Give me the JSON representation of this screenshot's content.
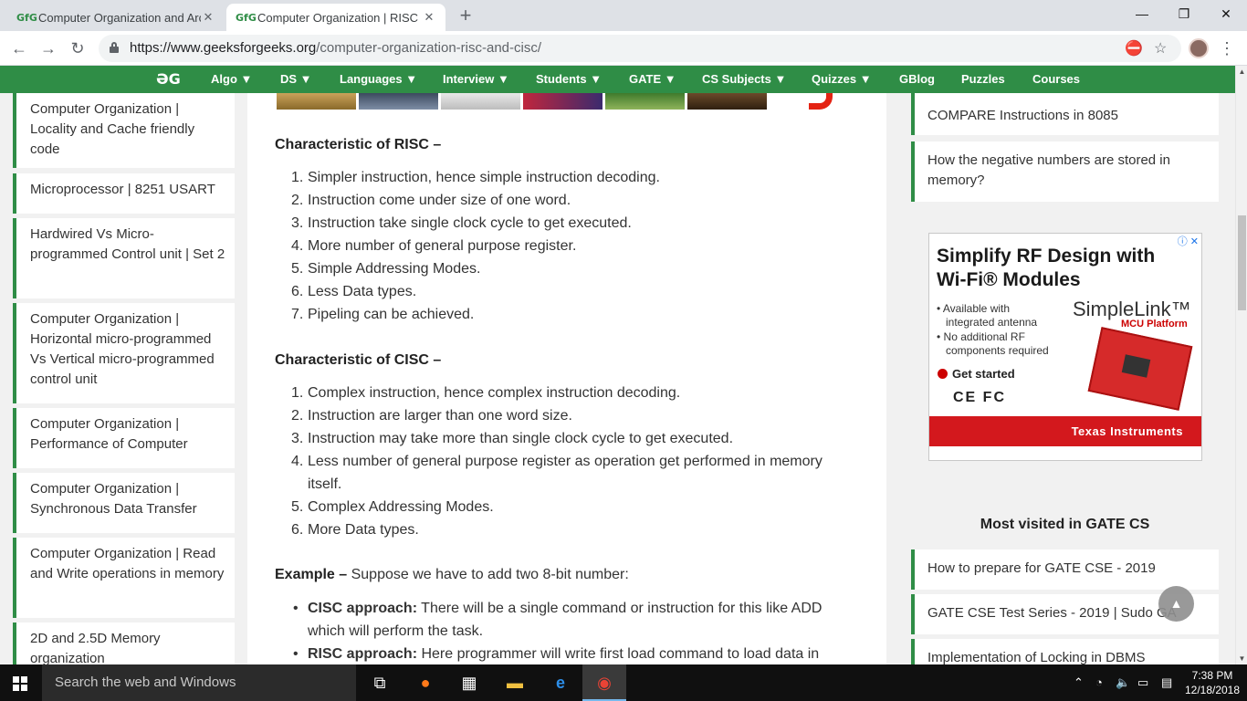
{
  "browser": {
    "tabs": [
      {
        "title": "Computer Organization and Arch",
        "favicon": "GfG"
      },
      {
        "title": "Computer Organization | RISC an",
        "favicon": "GfG"
      }
    ],
    "url_host": "https://www.geeksforgeeks.org",
    "url_path": "/computer-organization-risc-and-cisc/",
    "window_controls": {
      "minimize": "—",
      "maximize": "❐",
      "close": "✕"
    }
  },
  "site_nav": {
    "logo": "ƏG",
    "items": [
      "Algo ▼",
      "DS ▼",
      "Languages ▼",
      "Interview ▼",
      "Students ▼",
      "GATE ▼",
      "CS Subjects ▼",
      "Quizzes ▼",
      "GBlog",
      "Puzzles",
      "Courses"
    ]
  },
  "left_sidebar": {
    "items": [
      "Computer Organization | Locality and Cache friendly code",
      "Microprocessor | 8251 USART",
      "Hardwired Vs Micro-programmed Control unit | Set 2",
      "Computer Organization | Horizontal micro-programmed Vs Vertical micro-programmed control unit",
      "Computer Organization | Performance of Computer",
      "Computer Organization | Synchronous Data Transfer",
      "Computer Organization | Read and Write operations in memory",
      "2D and 2.5D Memory organization"
    ]
  },
  "article": {
    "risc_heading": "Characteristic of RISC –",
    "risc_items": [
      "Simpler instruction, hence simple instruction decoding.",
      "Instruction come under size of one word.",
      "Instruction take single clock cycle to get executed.",
      "More number of general purpose register.",
      "Simple Addressing Modes.",
      "Less Data types.",
      "Pipeling can be achieved."
    ],
    "cisc_heading": "Characteristic of CISC –",
    "cisc_items": [
      "Complex instruction, hence complex instruction decoding.",
      "Instruction are larger than one word size.",
      "Instruction may take more than single clock cycle to get executed.",
      "Less number of general purpose register as operation get performed in memory itself.",
      "Complex Addressing Modes.",
      "More Data types."
    ],
    "example_label": "Example –",
    "example_text": " Suppose we have to add two 8-bit number:",
    "approaches": [
      {
        "label": "CISC approach:",
        "text": " There will be a single command or instruction for this like ADD which will perform the task."
      },
      {
        "label": "RISC approach:",
        "text": " Here programmer will write first load command to load data in"
      }
    ]
  },
  "right_sidebar": {
    "top_items": [
      "COMPARE Instructions in 8085",
      "How the negative numbers are stored in memory?"
    ],
    "ad": {
      "title_line1": "Simplify RF Design with",
      "title_line2": "Wi-Fi® Modules",
      "bullet1": "• Available with",
      "bullet1b": "integrated antenna",
      "bullet2": "• No additional RF",
      "bullet2b": "components required",
      "brand": "SimpleLink™",
      "brand_sub": "MCU Platform",
      "cta": "Get started",
      "marks": "CE FC",
      "footer": "Texas Instruments",
      "choice": "ⓘ ✕"
    },
    "most_visited_title": "Most visited in GATE CS",
    "most_visited": [
      "How to prepare for GATE CSE - 2019",
      "GATE CSE Test Series - 2019 | Sudo GA",
      "Implementation of Locking in DBMS"
    ]
  },
  "taskbar": {
    "search_placeholder": "Search the web and Windows",
    "time": "7:38 PM",
    "date": "12/18/2018"
  }
}
